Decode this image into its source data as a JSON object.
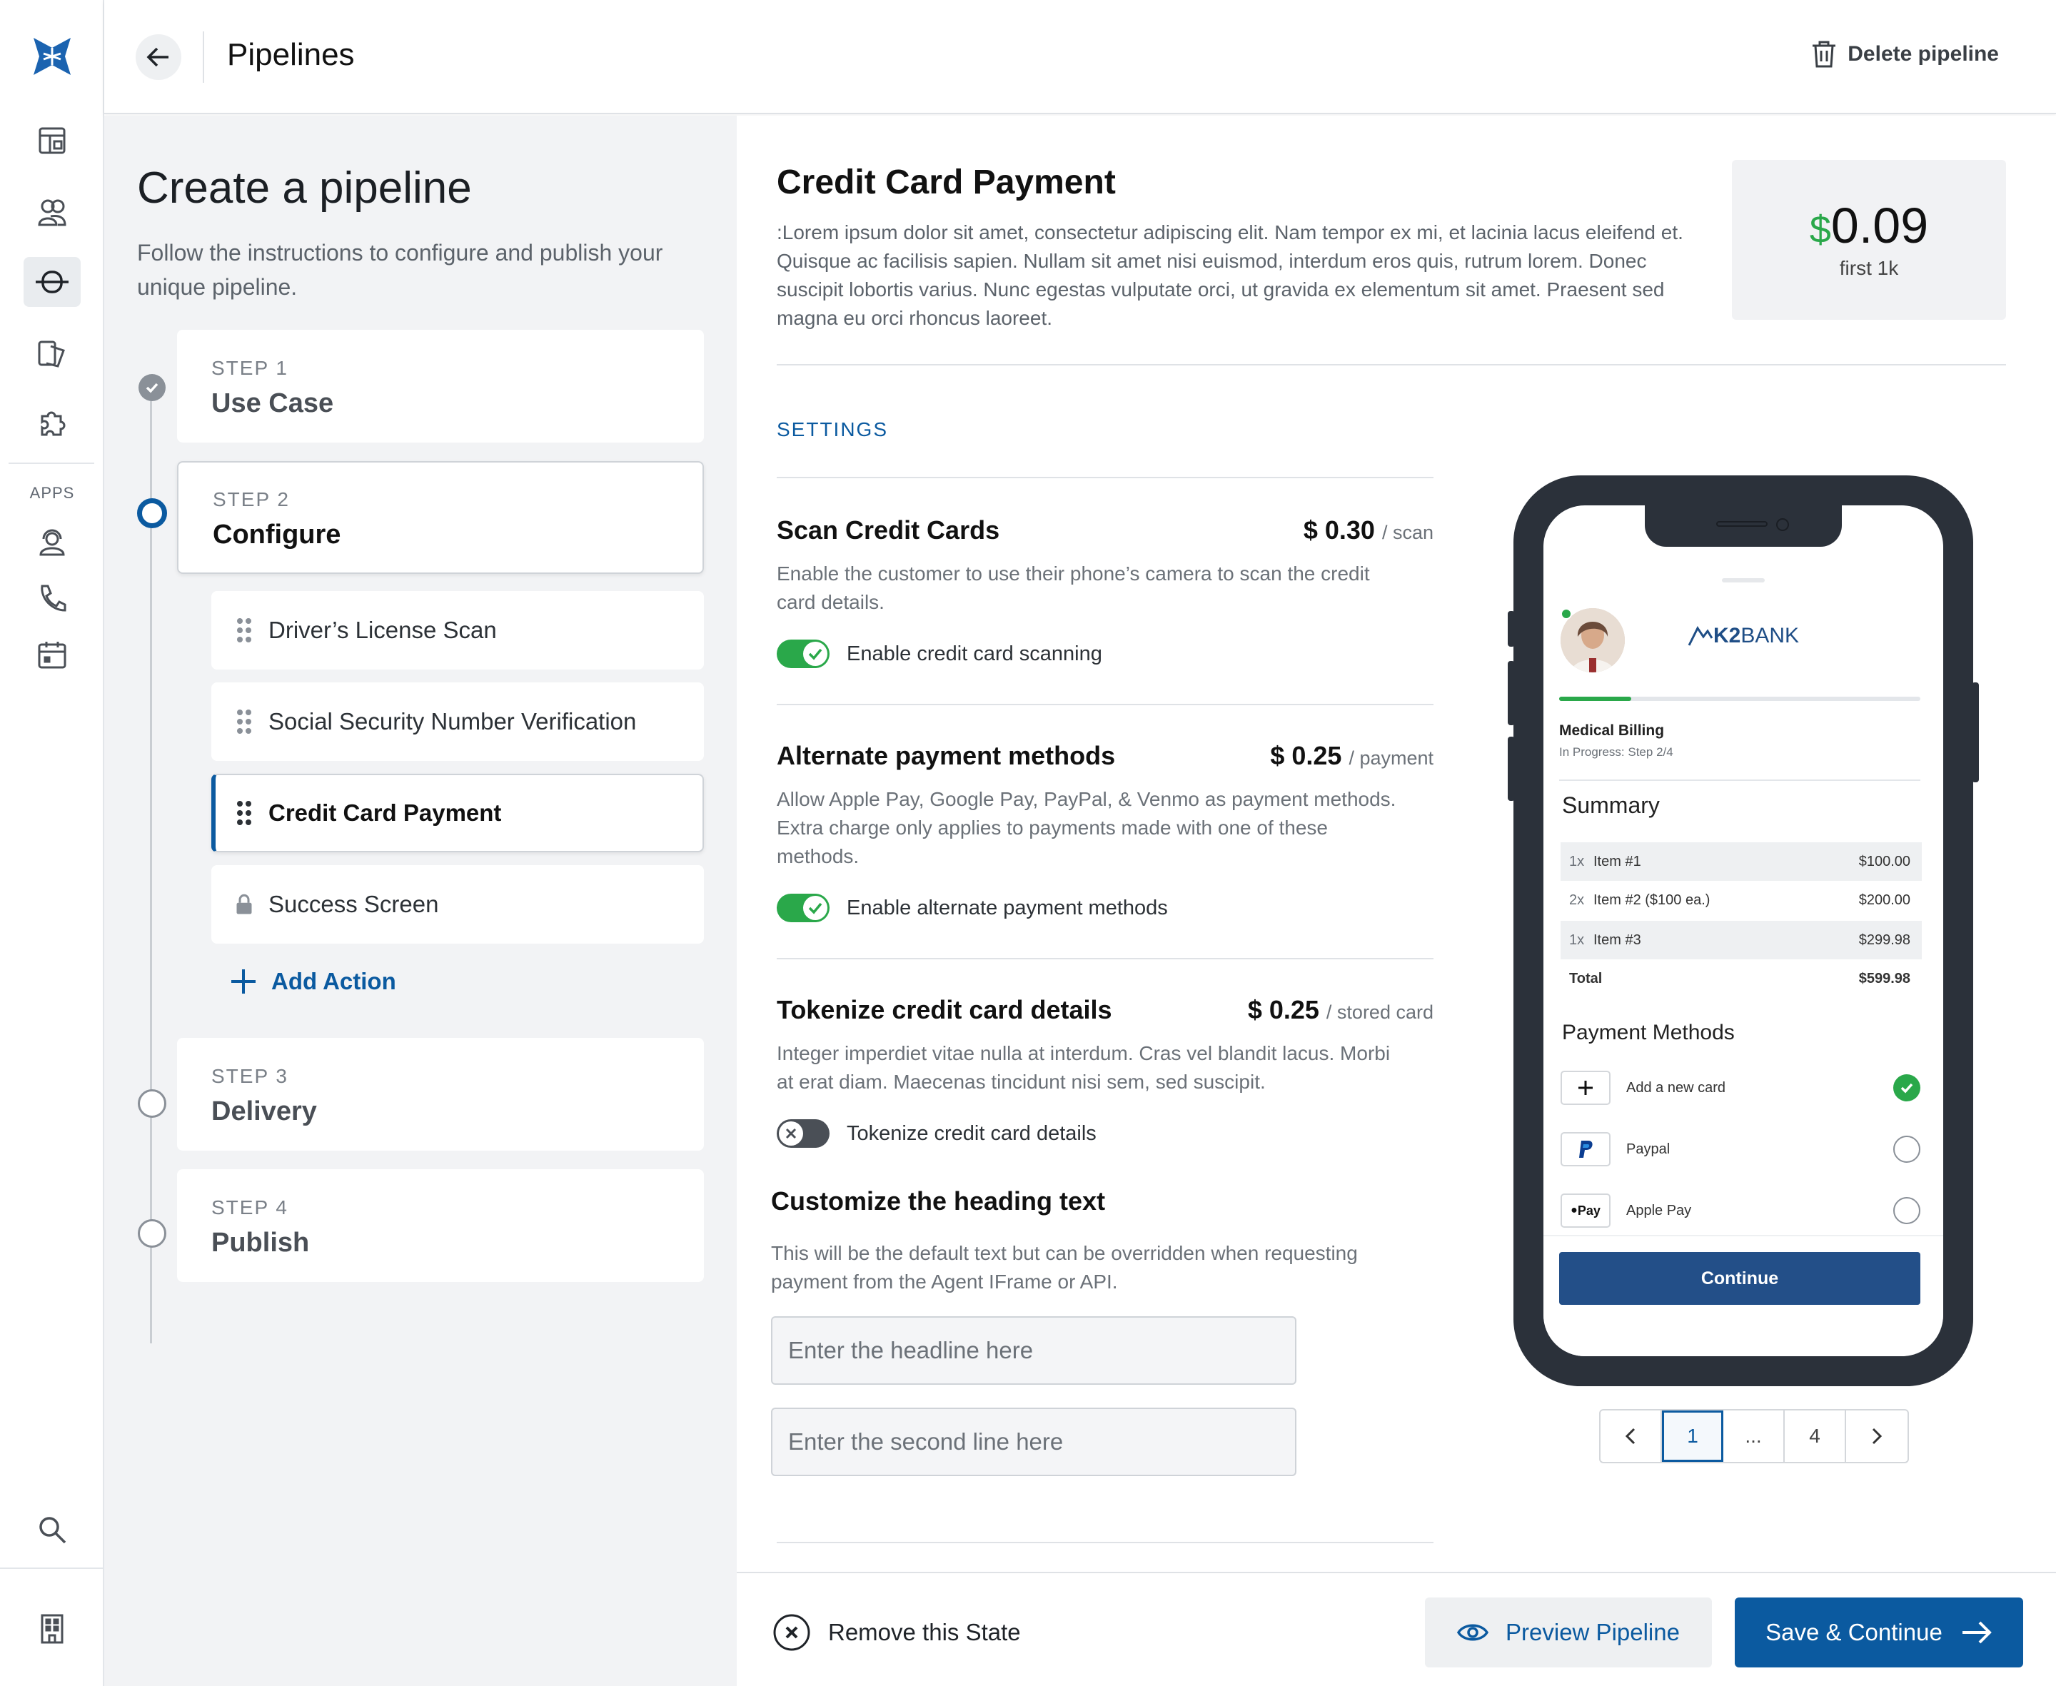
{
  "header": {
    "title": "Pipelines",
    "delete_label": "Delete pipeline"
  },
  "rail": {
    "apps_label": "APPS",
    "icons": [
      "logo-icon",
      "dashboard-icon",
      "users-icon",
      "pipelines-icon",
      "documents-icon",
      "puzzle-icon",
      "agent-icon",
      "phone-icon",
      "calendar-icon",
      "search-icon",
      "building-icon"
    ]
  },
  "left": {
    "title": "Create a pipeline",
    "subtitle": "Follow the instructions to configure and publish your unique pipeline.",
    "steps": [
      {
        "label": "STEP 1",
        "name": "Use Case",
        "state": "done"
      },
      {
        "label": "STEP 2",
        "name": "Configure",
        "state": "current"
      },
      {
        "label": "STEP 3",
        "name": "Delivery",
        "state": "pending"
      },
      {
        "label": "STEP 4",
        "name": "Publish",
        "state": "pending"
      }
    ],
    "actions": [
      {
        "name": "Driver’s License Scan",
        "icon": "drag-handle-icon"
      },
      {
        "name": "Social Security Number Verification",
        "icon": "drag-handle-icon"
      },
      {
        "name": "Credit Card Payment",
        "icon": "drag-handle-icon",
        "selected": true
      },
      {
        "name": "Success Screen",
        "icon": "lock-icon"
      }
    ],
    "add_action": "Add Action"
  },
  "content": {
    "title": "Credit Card Payment",
    "description": ":Lorem ipsum dolor sit amet, consectetur adipiscing elit. Nam tempor ex mi, et lacinia lacus eleifend et. Quisque ac facilisis sapien. Nullam sit amet nisi euismod, interdum eros quis, rutrum lorem. Donec suscipit lobortis varius. Nunc egestas vulputate orci, ut gravida ex elementum sit amet. Praesent sed magna eu orci rhoncus laoreet.",
    "price": {
      "currency": "$",
      "amount": "0.09",
      "unit": "first 1k"
    },
    "settings_label": "SETTINGS",
    "settings": [
      {
        "title": "Scan Credit Cards",
        "price": "$ 0.30",
        "unit": "/ scan",
        "desc": "Enable the customer to use their phone’s camera to scan the credit card details.",
        "toggle_label": "Enable credit card scanning",
        "enabled": true
      },
      {
        "title": "Alternate payment methods",
        "price": "$ 0.25",
        "unit": "/ payment",
        "desc": "Allow Apple Pay, Google Pay, PayPal, & Venmo as payment methods.  Extra charge only applies to payments made with one of these methods.",
        "toggle_label": "Enable alternate payment methods",
        "enabled": true
      },
      {
        "title": "Tokenize credit card details",
        "price": "$ 0.25",
        "unit": "/ stored card",
        "desc": "Integer imperdiet vitae nulla at interdum. Cras vel blandit lacus. Morbi at erat diam. Maecenas tincidunt nisi sem, sed suscipit.",
        "toggle_label": "Tokenize credit card details",
        "enabled": false
      }
    ],
    "customize": {
      "title": "Customize the heading text",
      "desc": "This will be the default text but can be overridden when requesting payment from the Agent IFrame or API.",
      "headline_placeholder": "Enter the headline here",
      "second_placeholder": "Enter the second line here"
    }
  },
  "phone": {
    "brand_bold": "K2",
    "brand_rest": "BANK",
    "progress": 0.2,
    "category": "Medical Billing",
    "status": "In Progress: Step 2/4",
    "summary_title": "Summary",
    "items": [
      {
        "qty": "1x",
        "name": "Item #1",
        "price": "$100.00"
      },
      {
        "qty": "2x",
        "name": "Item #2 ($100 ea.)",
        "price": "$200.00"
      },
      {
        "qty": "1x",
        "name": "Item #3",
        "price": "$299.98"
      }
    ],
    "total_label": "Total",
    "total_value": "$599.98",
    "pm_title": "Payment Methods",
    "methods": [
      {
        "name": "Add a new card",
        "icon": "plus-icon",
        "selected": true
      },
      {
        "name": "Paypal",
        "icon": "paypal-icon",
        "selected": false
      },
      {
        "name": "Apple Pay",
        "icon": "apple-pay-icon",
        "icon_text": "Pay",
        "selected": false
      }
    ],
    "continue_label": "Continue"
  },
  "pager": {
    "pages": [
      "1",
      "...",
      "4"
    ],
    "current": "1"
  },
  "footer": {
    "remove_label": "Remove this State",
    "preview_label": "Preview Pipeline",
    "save_label": "Save & Continue"
  },
  "colors": {
    "accent": "#0b5aa0",
    "success": "#2aa84a",
    "dark": "#2b313a",
    "phone_button": "#234f88"
  }
}
